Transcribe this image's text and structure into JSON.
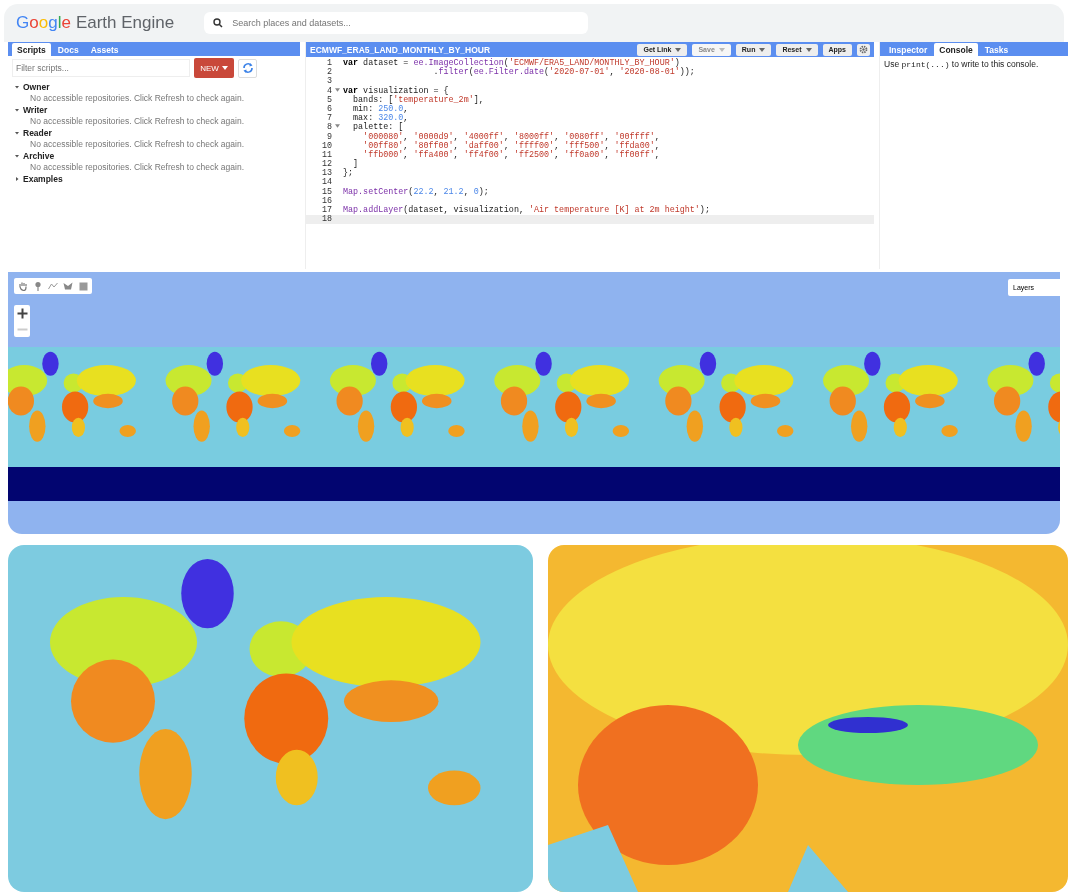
{
  "header": {
    "logo_brand": "Google",
    "logo_product": "Earth Engine",
    "search": {
      "placeholder": "Search places and datasets..."
    }
  },
  "left_panel": {
    "tabs": [
      {
        "label": "Scripts",
        "selected": true
      },
      {
        "label": "Docs",
        "selected": false
      },
      {
        "label": "Assets",
        "selected": false
      }
    ],
    "filter": {
      "placeholder": "Filter scripts..."
    },
    "new_button": "NEW",
    "tree": [
      {
        "label": "Owner",
        "expanded": true,
        "message": "No accessible repositories. Click Refresh to check again."
      },
      {
        "label": "Writer",
        "expanded": true,
        "message": "No accessible repositories. Click Refresh to check again."
      },
      {
        "label": "Reader",
        "expanded": true,
        "message": "No accessible repositories. Click Refresh to check again."
      },
      {
        "label": "Archive",
        "expanded": true,
        "message": "No accessible repositories. Click Refresh to check again."
      },
      {
        "label": "Examples",
        "expanded": false
      }
    ]
  },
  "editor": {
    "title": "ECMWF_ERA5_LAND_MONTHLY_BY_HOUR",
    "buttons": [
      {
        "label": "Get Link",
        "dropdown": true,
        "disabled": false
      },
      {
        "label": "Save",
        "dropdown": true,
        "disabled": true
      },
      {
        "label": "Run",
        "dropdown": true,
        "disabled": false
      },
      {
        "label": "Reset",
        "dropdown": true,
        "disabled": false
      },
      {
        "label": "Apps",
        "dropdown": false,
        "disabled": false
      }
    ],
    "lines": [
      {
        "number": "1",
        "fold": false,
        "current": false,
        "tokens": [
          {
            "kind": "keyword",
            "text": "var"
          },
          {
            "kind": "plain",
            "text": " dataset = "
          },
          {
            "kind": "call",
            "text": "ee.ImageCollection"
          },
          {
            "kind": "plain",
            "text": "("
          },
          {
            "kind": "string",
            "text": "'ECMWF/ERA5_LAND/MONTHLY_BY_HOUR'"
          },
          {
            "kind": "plain",
            "text": ")"
          }
        ]
      },
      {
        "number": "2",
        "fold": false,
        "current": false,
        "tokens": [
          {
            "kind": "plain",
            "text": "                  ."
          },
          {
            "kind": "call",
            "text": "filter"
          },
          {
            "kind": "plain",
            "text": "("
          },
          {
            "kind": "call",
            "text": "ee.Filter.date"
          },
          {
            "kind": "plain",
            "text": "("
          },
          {
            "kind": "string",
            "text": "'2020-07-01'"
          },
          {
            "kind": "plain",
            "text": ", "
          },
          {
            "kind": "string",
            "text": "'2020-08-01'"
          },
          {
            "kind": "plain",
            "text": "));"
          }
        ]
      },
      {
        "number": "3",
        "fold": false,
        "current": false
      },
      {
        "number": "4",
        "fold": true,
        "current": false,
        "tokens": [
          {
            "kind": "keyword",
            "text": "var"
          },
          {
            "kind": "plain",
            "text": " visualization = {"
          }
        ]
      },
      {
        "number": "5",
        "fold": false,
        "current": false,
        "tokens": [
          {
            "kind": "plain",
            "text": "  bands: ["
          },
          {
            "kind": "string",
            "text": "'temperature_2m'"
          },
          {
            "kind": "plain",
            "text": "],"
          }
        ]
      },
      {
        "number": "6",
        "fold": false,
        "current": false,
        "tokens": [
          {
            "kind": "plain",
            "text": "  min: "
          },
          {
            "kind": "number",
            "text": "250.0"
          },
          {
            "kind": "plain",
            "text": ","
          }
        ]
      },
      {
        "number": "7",
        "fold": false,
        "current": false,
        "tokens": [
          {
            "kind": "plain",
            "text": "  max: "
          },
          {
            "kind": "number",
            "text": "320.0"
          },
          {
            "kind": "plain",
            "text": ","
          }
        ]
      },
      {
        "number": "8",
        "fold": true,
        "current": false,
        "tokens": [
          {
            "kind": "plain",
            "text": "  palette: ["
          }
        ]
      },
      {
        "number": "9",
        "fold": false,
        "current": false,
        "tokens": [
          {
            "kind": "string",
            "text": "    '000080'"
          },
          {
            "kind": "plain",
            "text": ", "
          },
          {
            "kind": "string",
            "text": "'0000d9'"
          },
          {
            "kind": "plain",
            "text": ", "
          },
          {
            "kind": "string",
            "text": "'4000ff'"
          },
          {
            "kind": "plain",
            "text": ", "
          },
          {
            "kind": "string",
            "text": "'8000ff'"
          },
          {
            "kind": "plain",
            "text": ", "
          },
          {
            "kind": "string",
            "text": "'0080ff'"
          },
          {
            "kind": "plain",
            "text": ", "
          },
          {
            "kind": "string",
            "text": "'00ffff'"
          },
          {
            "kind": "plain",
            "text": ","
          }
        ]
      },
      {
        "number": "10",
        "fold": false,
        "current": false,
        "tokens": [
          {
            "kind": "string",
            "text": "    '00ff80'"
          },
          {
            "kind": "plain",
            "text": ", "
          },
          {
            "kind": "string",
            "text": "'80ff00'"
          },
          {
            "kind": "plain",
            "text": ", "
          },
          {
            "kind": "string",
            "text": "'daff00'"
          },
          {
            "kind": "plain",
            "text": ", "
          },
          {
            "kind": "string",
            "text": "'ffff00'"
          },
          {
            "kind": "plain",
            "text": ", "
          },
          {
            "kind": "string",
            "text": "'fff500'"
          },
          {
            "kind": "plain",
            "text": ", "
          },
          {
            "kind": "string",
            "text": "'ffda00'"
          },
          {
            "kind": "plain",
            "text": ","
          }
        ]
      },
      {
        "number": "11",
        "fold": false,
        "current": false,
        "tokens": [
          {
            "kind": "string",
            "text": "    'ffb000'"
          },
          {
            "kind": "plain",
            "text": ", "
          },
          {
            "kind": "string",
            "text": "'ffa400'"
          },
          {
            "kind": "plain",
            "text": ", "
          },
          {
            "kind": "string",
            "text": "'ff4f00'"
          },
          {
            "kind": "plain",
            "text": ", "
          },
          {
            "kind": "string",
            "text": "'ff2500'"
          },
          {
            "kind": "plain",
            "text": ", "
          },
          {
            "kind": "string",
            "text": "'ff0a00'"
          },
          {
            "kind": "plain",
            "text": ", "
          },
          {
            "kind": "string",
            "text": "'ff00ff'"
          },
          {
            "kind": "plain",
            "text": ","
          }
        ]
      },
      {
        "number": "12",
        "fold": false,
        "current": false,
        "tokens": [
          {
            "kind": "plain",
            "text": "  ]"
          }
        ]
      },
      {
        "number": "13",
        "fold": false,
        "current": false,
        "tokens": [
          {
            "kind": "plain",
            "text": "};"
          }
        ]
      },
      {
        "number": "14",
        "fold": false,
        "current": false
      },
      {
        "number": "15",
        "fold": false,
        "current": false,
        "tokens": [
          {
            "kind": "call",
            "text": "Map.setCenter"
          },
          {
            "kind": "plain",
            "text": "("
          },
          {
            "kind": "number",
            "text": "22.2"
          },
          {
            "kind": "plain",
            "text": ", "
          },
          {
            "kind": "number",
            "text": "21.2"
          },
          {
            "kind": "plain",
            "text": ", "
          },
          {
            "kind": "number",
            "text": "0"
          },
          {
            "kind": "plain",
            "text": ");"
          }
        ]
      },
      {
        "number": "16",
        "fold": false,
        "current": false
      },
      {
        "number": "17",
        "fold": false,
        "current": false,
        "tokens": [
          {
            "kind": "call",
            "text": "Map.addLayer"
          },
          {
            "kind": "plain",
            "text": "(dataset, visualization, "
          },
          {
            "kind": "string",
            "text": "'Air temperature [K] at 2m height'"
          },
          {
            "kind": "plain",
            "text": ");"
          }
        ]
      },
      {
        "number": "18",
        "fold": false,
        "current": true
      }
    ]
  },
  "right_panel": {
    "tabs": [
      {
        "label": "Inspector",
        "selected": false
      },
      {
        "label": "Console",
        "selected": true
      },
      {
        "label": "Tasks",
        "selected": false
      }
    ],
    "console_message": {
      "before": "Use ",
      "code": "print(...)",
      "after": " to write to this console."
    }
  },
  "map": {
    "layers_button": "Layers"
  }
}
